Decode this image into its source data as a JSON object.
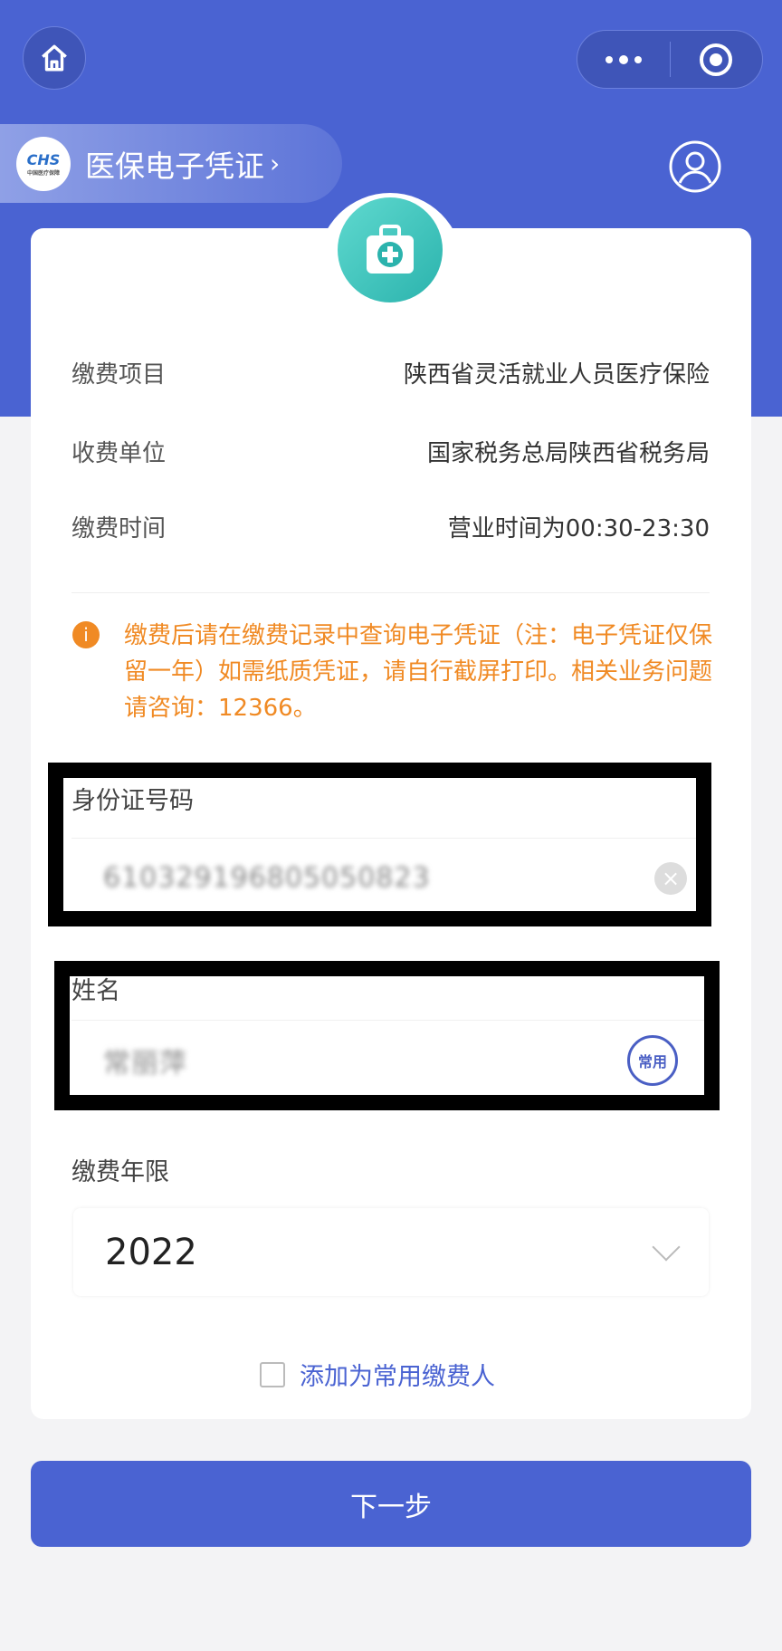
{
  "colors": {
    "brand_blue": "#4a63d2",
    "notice_orange": "#f08a24",
    "teal": "#2bb3ad"
  },
  "nav": {
    "home_icon": "home-icon",
    "more_icon": "more-dots-icon",
    "close_icon": "target-circle-icon"
  },
  "banner": {
    "logo_text": "CHS",
    "logo_sub": "中国医疗保障",
    "title": "医保电子凭证",
    "chevron": "›"
  },
  "info_rows": [
    {
      "label": "缴费项目",
      "value": "陕西省灵活就业人员医疗保险"
    },
    {
      "label": "收费单位",
      "value": "国家税务总局陕西省税务局"
    },
    {
      "label": "缴费时间",
      "value": "营业时间为00:30-23:30"
    }
  ],
  "notice": {
    "icon": "i",
    "text": "缴费后请在缴费记录中查询电子凭证（注：电子凭证仅保留一年）如需纸质凭证，请自行截屏打印。相关业务问题请咨询：12366。"
  },
  "form": {
    "id_label": "身份证号码",
    "id_value": "610329196805050823",
    "clear": "×",
    "name_label": "姓名",
    "name_value": "常丽萍",
    "common_badge": "常用",
    "year_label": "缴费年限",
    "year_value": "2022",
    "add_common_label": "添加为常用缴费人"
  },
  "next_button": "下一步"
}
